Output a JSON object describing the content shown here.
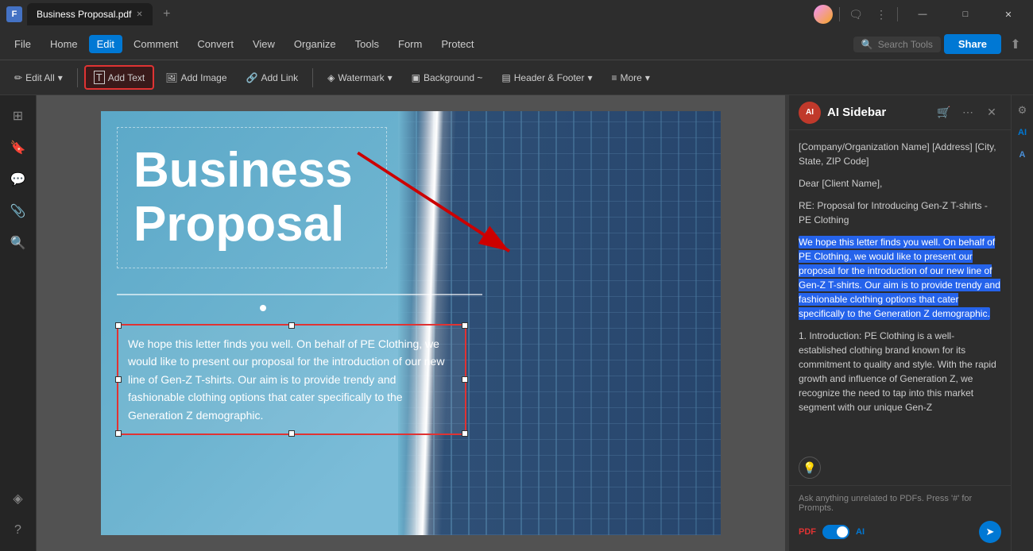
{
  "titleBar": {
    "appIcon": "F",
    "tab": {
      "title": "Business Proposal.pdf",
      "modified": true
    },
    "newTabLabel": "+",
    "controls": {
      "minimize": "—",
      "maximize": "□",
      "close": "✕"
    }
  },
  "menuBar": {
    "items": [
      "File",
      "Home",
      "Edit",
      "Comment",
      "Convert",
      "View",
      "Organize",
      "Tools",
      "Form",
      "Protect"
    ],
    "activeItem": "Edit",
    "searchPlaceholder": "Search Tools",
    "shareLabel": "Share"
  },
  "toolbar": {
    "editAll": "Edit All",
    "addText": "Add Text",
    "addImage": "Add Image",
    "addLink": "Add Link",
    "watermark": "Watermark",
    "background": "Background ~",
    "headerFooter": "Header & Footer",
    "more": "More"
  },
  "pdf": {
    "title1": "Business",
    "title2": "Proposal",
    "bodyText": "We hope this letter finds you well. On behalf of PE Clothing, we would like to present our proposal for the introduction of our new line of Gen-Z T-shirts. Our aim is to provide trendy and fashionable clothing options that cater specifically to the Generation Z demographic."
  },
  "aiSidebar": {
    "title": "AI Sidebar",
    "content": {
      "address": "[Company/Organization Name]\n[Address]\n[City, State, ZIP Code]",
      "greeting": "Dear [Client Name],",
      "subject": "RE: Proposal for Introducing Gen-Z T-shirts - PE Clothing",
      "highlightedText": "We hope this letter finds you well. On behalf of PE Clothing, we would like to present our proposal for the introduction of our new line of Gen-Z T-shirts. Our aim is to provide trendy and fashionable clothing options that cater specifically to the Generation Z demographic.",
      "intro": "1. Introduction:\nPE Clothing is a well-established clothing brand known for its commitment to quality and style. With the rapid growth and influence of Generation Z, we recognize the need to tap into this market segment with our unique Gen-Z"
    },
    "inputPlaceholder": "Ask anything unrelated to PDFs. Press '#' for Prompts.",
    "togglePdf": "PDF",
    "toggleAi": "AI"
  }
}
